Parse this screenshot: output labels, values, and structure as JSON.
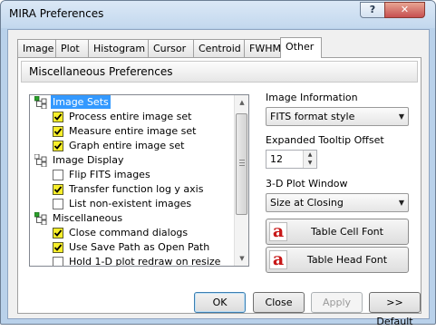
{
  "window": {
    "title": "MIRA Preferences"
  },
  "titlebar": {
    "help_label": "?",
    "close_label": "✕"
  },
  "tabs": [
    "Image",
    "Plot",
    "Histogram",
    "Cursor",
    "Centroid",
    "FWHM",
    "Other"
  ],
  "active_tab": "Other",
  "section": {
    "title": "Miscellaneous Preferences"
  },
  "tree": {
    "groups": [
      {
        "label": "Image Sets",
        "selected": true,
        "items": [
          {
            "label": "Process entire image set",
            "checked": true
          },
          {
            "label": "Measure entire image set",
            "checked": true
          },
          {
            "label": "Graph entire image set",
            "checked": true
          }
        ]
      },
      {
        "label": "Image Display",
        "selected": false,
        "items": [
          {
            "label": "Flip FITS images",
            "checked": false
          },
          {
            "label": "Transfer function log y axis",
            "checked": true
          },
          {
            "label": "List non-existent images",
            "checked": false
          }
        ]
      },
      {
        "label": "Miscellaneous",
        "selected": false,
        "items": [
          {
            "label": "Close command dialogs",
            "checked": true
          },
          {
            "label": "Use Save Path as Open Path",
            "checked": true
          },
          {
            "label": "Hold 1-D plot redraw on resize",
            "checked": false
          }
        ]
      }
    ]
  },
  "image_information": {
    "label": "Image Information",
    "value": "FITS format style"
  },
  "tooltip_offset": {
    "label": "Expanded Tooltip Offset",
    "value": "12"
  },
  "plot_window": {
    "label": "3-D Plot Window",
    "value": "Size at Closing"
  },
  "font_buttons": {
    "icon_letter": "a",
    "table_cell": "Table Cell Font",
    "table_head": "Table Head Font"
  },
  "buttons": {
    "ok": "OK",
    "close": "Close",
    "apply": "Apply",
    "default": ">> Default"
  },
  "colors": {
    "selection": "#3399ff",
    "checkbox_fill": "#f8ef2a",
    "icon_red": "#c81818",
    "frame": "#b9d1ea"
  }
}
